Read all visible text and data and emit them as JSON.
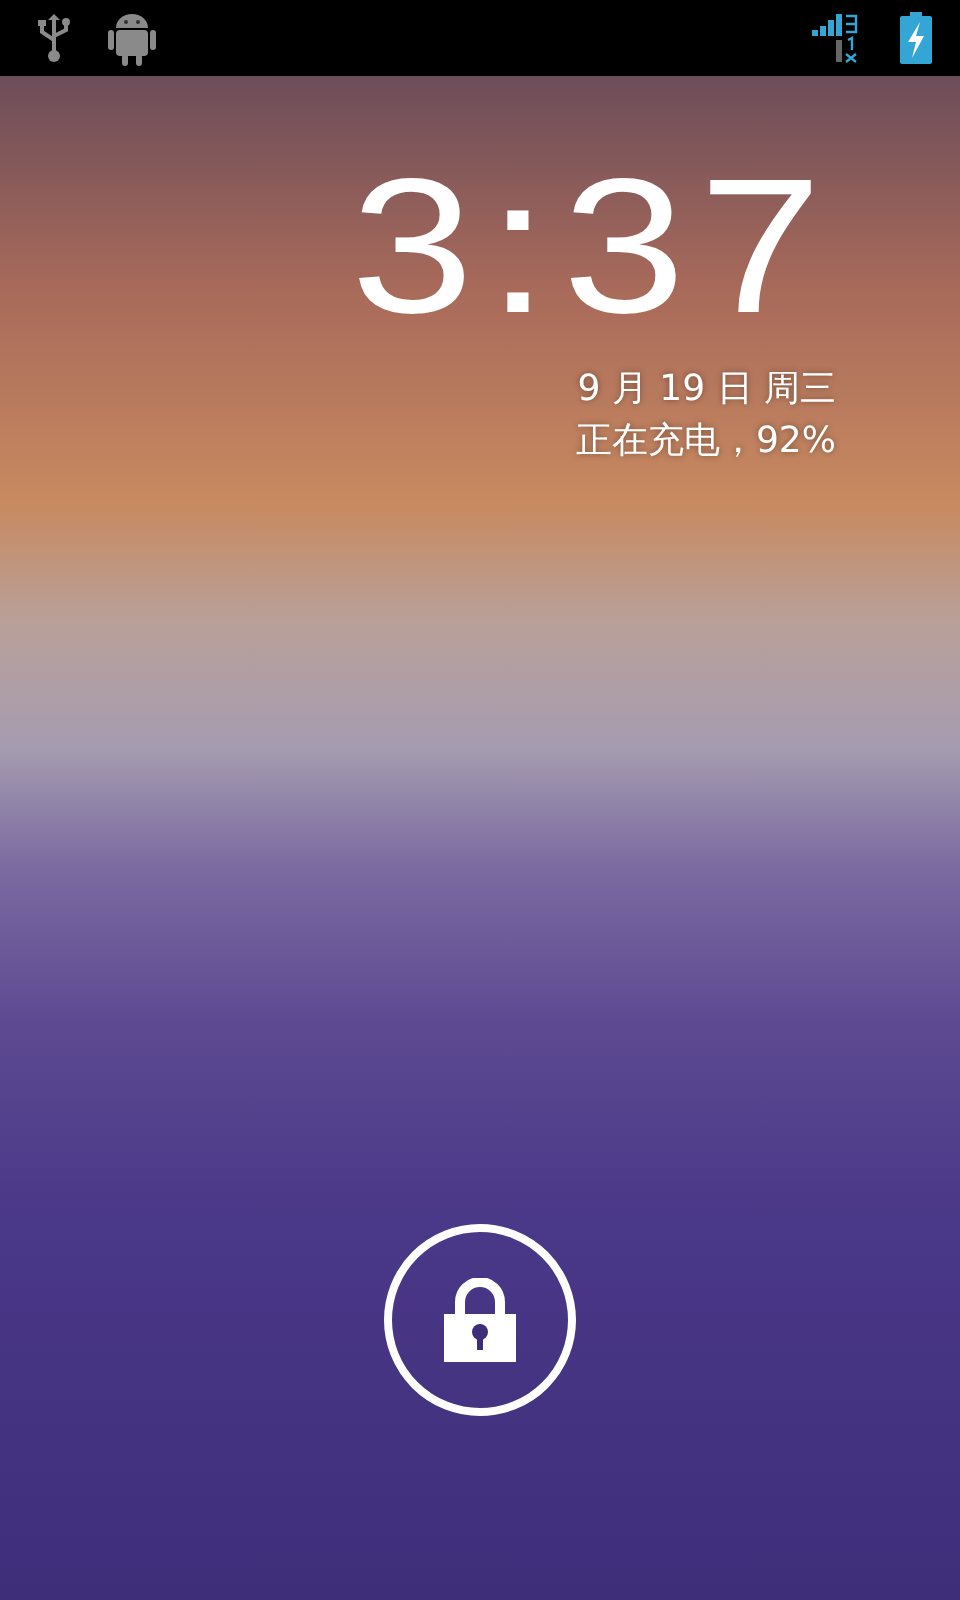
{
  "status_bar": {
    "left_icons": [
      {
        "kind": "usb"
      },
      {
        "kind": "android"
      }
    ]
  },
  "lock_screen": {
    "time": "3:37",
    "date": "9 月 19 日 周三",
    "charging_status": "正在充电，92%"
  }
}
